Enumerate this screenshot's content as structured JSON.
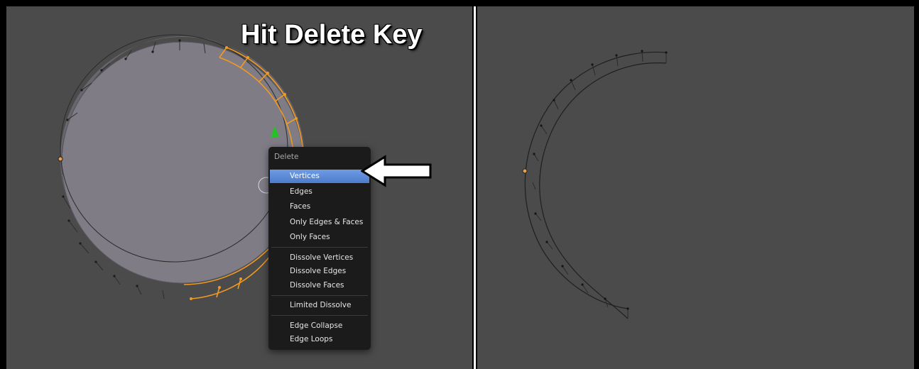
{
  "caption": "Hit Delete Key",
  "menu": {
    "title": "Delete",
    "items": [
      {
        "label": "Vertices",
        "active": true
      },
      {
        "label": "Edges"
      },
      {
        "label": "Faces"
      },
      {
        "label": "Only Edges & Faces"
      },
      {
        "label": "Only Faces"
      },
      {
        "label": "Dissolve Vertices"
      },
      {
        "label": "Dissolve Edges"
      },
      {
        "label": "Dissolve Faces"
      },
      {
        "label": "Limited Dissolve"
      },
      {
        "label": "Edge Collapse"
      },
      {
        "label": "Edge Loops"
      }
    ]
  },
  "colors": {
    "viewport_bg": "#4b4b4b",
    "face_fill": "#7f7c86",
    "selected_edge": "#f29a21",
    "menu_bg": "#1b1b1b",
    "menu_highlight": "#5a87d6"
  },
  "icons": [
    "annotation-arrow-icon",
    "transform-gizmo-icon",
    "3d-cursor-icon"
  ]
}
